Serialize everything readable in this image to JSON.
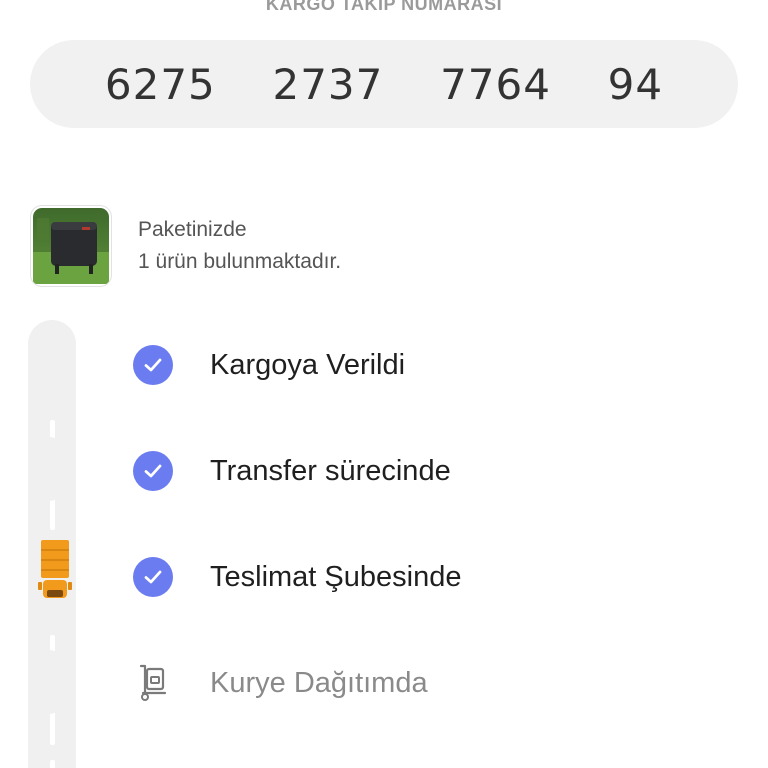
{
  "tracking": {
    "label": "KARGO TAKİP NUMARASI",
    "number": "6275  2737  7764  94"
  },
  "package": {
    "line1": "Paketinizde",
    "line2": "1 ürün bulunmaktadır.",
    "thumb_icon": "product-image"
  },
  "colors": {
    "accent": "#6b7cf0",
    "truck": "#f29a1b",
    "rail": "#f0f0f0"
  },
  "steps": [
    {
      "label": "Kargoya Verildi",
      "status": "done",
      "icon": "check-icon"
    },
    {
      "label": "Transfer sürecinde",
      "status": "done",
      "icon": "check-icon"
    },
    {
      "label": "Teslimat Şubesinde",
      "status": "done",
      "icon": "check-icon"
    },
    {
      "label": "Kurye Dağıtımda",
      "status": "pending",
      "icon": "courier-icon"
    }
  ]
}
